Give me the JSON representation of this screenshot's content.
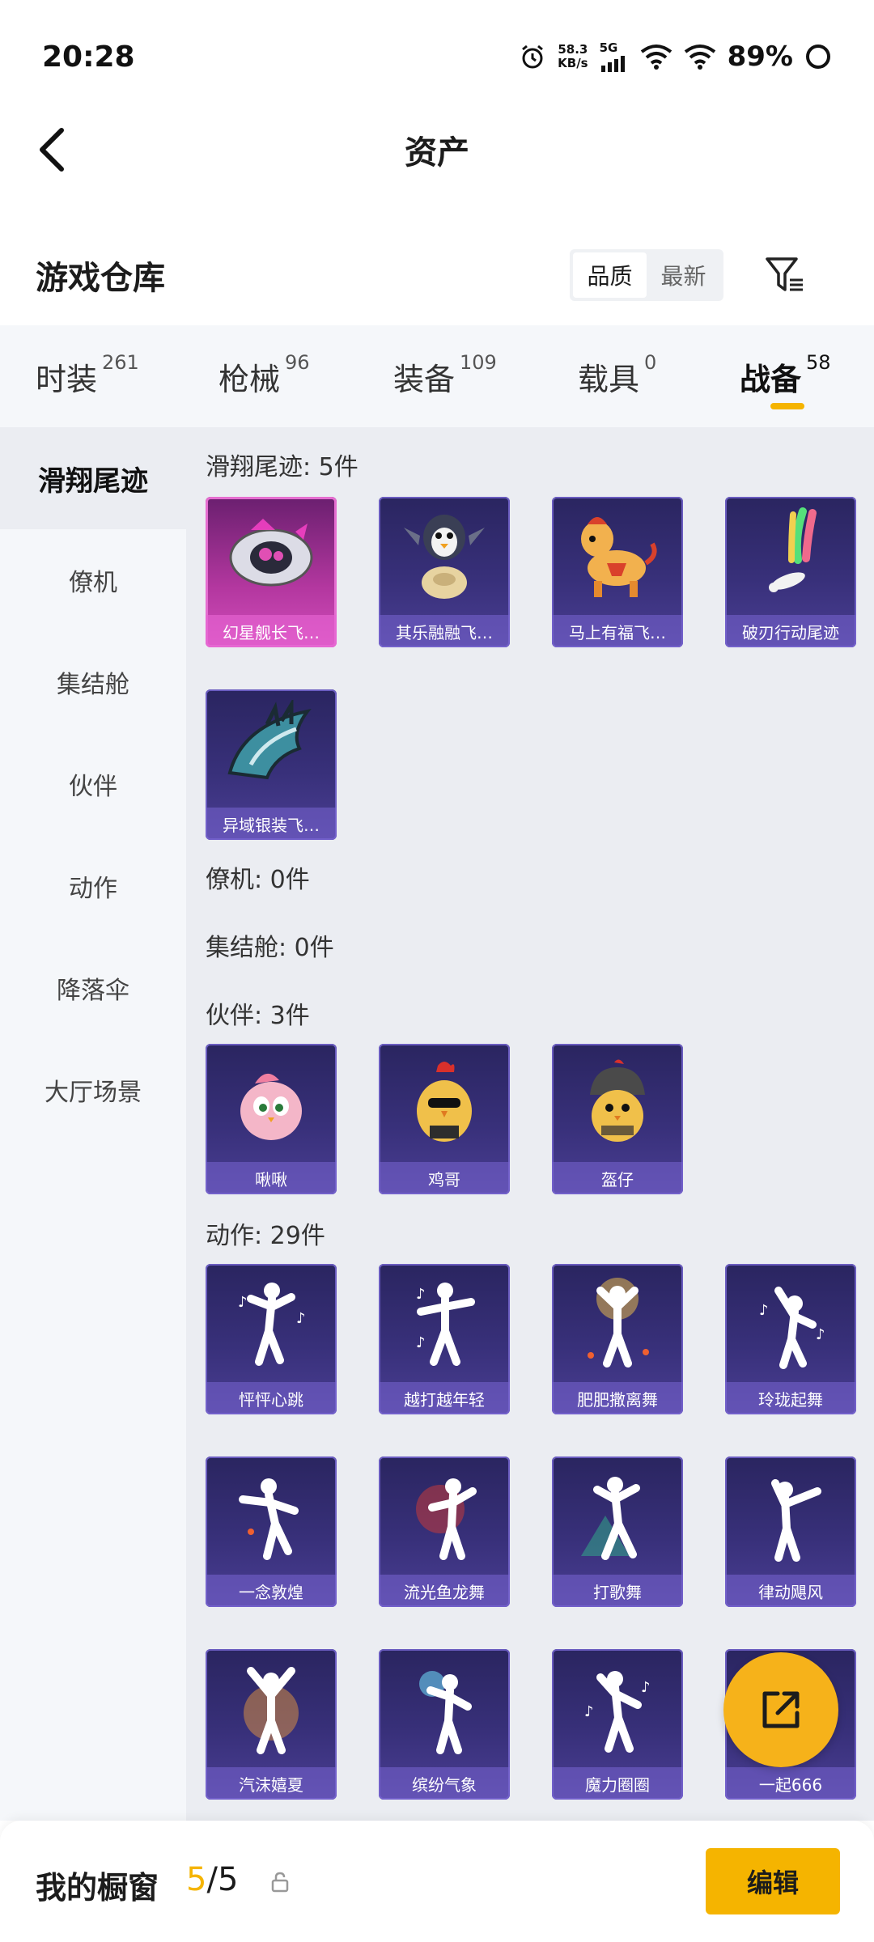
{
  "status_bar": {
    "time": "20:28",
    "net_speed_value": "58.3",
    "net_speed_unit": "KB/s",
    "network_type": "5G",
    "battery": "89%"
  },
  "header": {
    "title": "资产"
  },
  "warehouse": {
    "title": "游戏仓库",
    "sort_options": [
      "品质",
      "最新"
    ],
    "active_sort": "品质"
  },
  "category_tabs": [
    {
      "label": "时装",
      "count": "261"
    },
    {
      "label": "枪械",
      "count": "96"
    },
    {
      "label": "装备",
      "count": "109"
    },
    {
      "label": "载具",
      "count": "0"
    },
    {
      "label": "战备",
      "count": "58",
      "active": true
    }
  ],
  "sidebar": {
    "items": [
      "滑翔尾迹",
      "僚机",
      "集结舱",
      "伙伴",
      "动作",
      "降落伞",
      "大厅场景"
    ],
    "active": "滑翔尾迹"
  },
  "sections": {
    "glide": {
      "title": "滑翔尾迹: 5件",
      "items": [
        "幻星舰长飞…",
        "其乐融融飞…",
        "马上有福飞…",
        "破刃行动尾迹",
        "异域银装飞…"
      ]
    },
    "wingman": {
      "title": "僚机: 0件"
    },
    "rally": {
      "title": "集结舱: 0件"
    },
    "partner": {
      "title": "伙伴: 3件",
      "items": [
        "啾啾",
        "鸡哥",
        "盔仔"
      ]
    },
    "emote": {
      "title": "动作: 29件",
      "items": [
        "怦怦心跳",
        "越打越年轻",
        "肥肥撒离舞",
        "玲珑起舞",
        "一念敦煌",
        "流光鱼龙舞",
        "打歌舞",
        "律动飓风",
        "汽沫嬉夏",
        "缤纷气象",
        "魔力圈圈",
        "一起666"
      ]
    }
  },
  "bottom_bar": {
    "label": "我的橱窗",
    "current": "5",
    "separator": "/",
    "total": "5",
    "edit_label": "编辑"
  },
  "colors": {
    "accent": "#f5b400",
    "card_bg": "#38307a",
    "card_highlight": "#d24dbb"
  }
}
